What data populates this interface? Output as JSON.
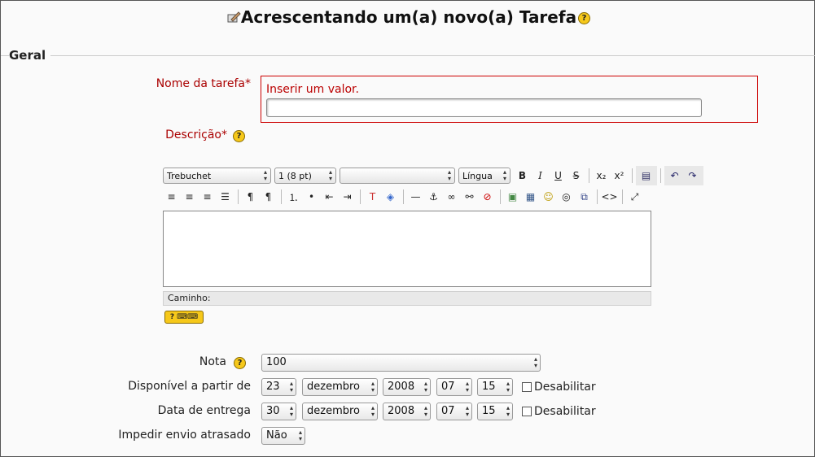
{
  "page": {
    "title": "Acrescentando um(a) novo(a) Tarefa",
    "legend": "Geral"
  },
  "name_field": {
    "label": "Nome da tarefa*",
    "error": "Inserir um valor.",
    "value": ""
  },
  "description": {
    "label": "Descrição*",
    "font_family": "Trebuchet",
    "font_size": "1 (8 pt)",
    "format": "",
    "language": "Língua",
    "path_label": "Caminho:"
  },
  "grade": {
    "label": "Nota",
    "value": "100"
  },
  "available_from": {
    "label": "Disponível a partir de",
    "day": "23",
    "month": "dezembro",
    "year": "2008",
    "hour": "07",
    "minute": "15",
    "disable_label": "Desabilitar"
  },
  "due_date": {
    "label": "Data de entrega",
    "day": "30",
    "month": "dezembro",
    "year": "2008",
    "hour": "07",
    "minute": "15",
    "disable_label": "Desabilitar"
  },
  "prevent_late": {
    "label": "Impedir envio atrasado",
    "value": "Não"
  },
  "colors": {
    "required": "#aa0000",
    "help": "#f6c81a"
  }
}
